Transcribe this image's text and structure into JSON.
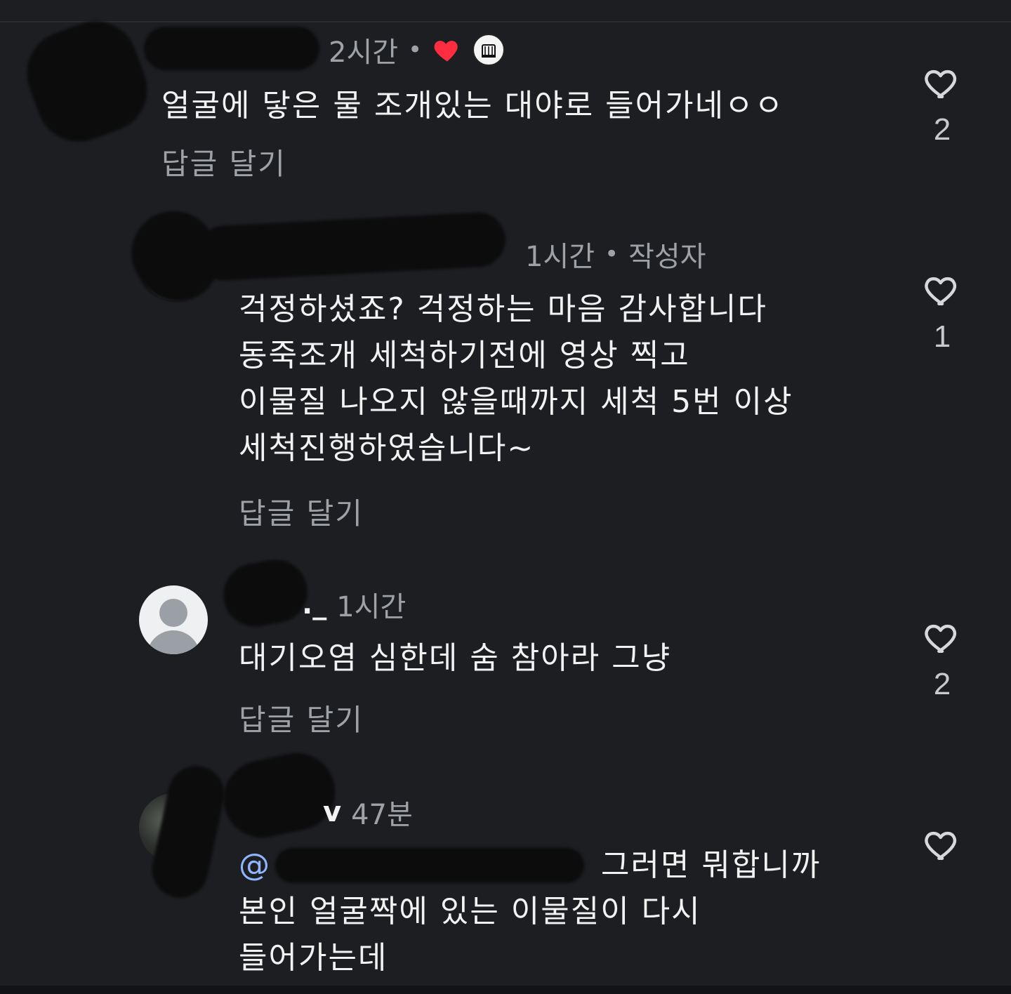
{
  "comments": [
    {
      "username_visible": "",
      "time": "2시간",
      "text_lines": [
        "얼굴에 닿은 물 조개있는 대야로 들어가네ㅇㅇ"
      ],
      "reply_label": "답글 달기",
      "like_count": "2",
      "liked_by_creator": true
    },
    {
      "username_visible": "",
      "time": "1시간",
      "creator_label": "작성자",
      "text_lines": [
        "걱정하셨죠? 걱정하는 마음 감사합니다",
        "동죽조개 세척하기전에 영상 찍고",
        "이물질 나오지 않을때까지 세척 5번 이상",
        "세척진행하였습니다~"
      ],
      "reply_label": "답글 달기",
      "like_count": "1"
    },
    {
      "username_visible": "._",
      "time": "1시간",
      "text_lines": [
        "대기오염 심한데 숨 참아라 그냥"
      ],
      "reply_label": "답글 달기",
      "like_count": "2"
    },
    {
      "username_visible": "v",
      "time": "47분",
      "mention_visible": "@",
      "text_lines": [
        "그러면 뭐합니까",
        "본인 얼굴짝에 있는 이물질이 다시",
        "들어가는데"
      ]
    }
  ],
  "icons": {
    "like": "heart-outline-icon",
    "creator_like": "heart-filled-icon",
    "default_avatar": "default-user-icon"
  },
  "colors": {
    "background": "#1c1e21",
    "text": "#f2f2f2",
    "muted": "#9ea1a6",
    "heart_red": "#ff2d3f"
  }
}
